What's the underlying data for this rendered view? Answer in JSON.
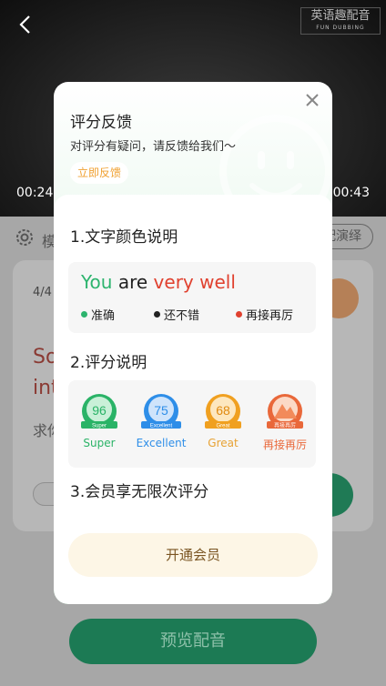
{
  "video": {
    "watermark_main": "英语趣配音",
    "watermark_sub": "FUN DUBBING",
    "time_current": "00:24",
    "time_total": "00:43"
  },
  "background": {
    "mode_label": "模",
    "rehearse_label": "配演绎",
    "page_indicator": "4/4",
    "sentence_fragment": "So\nint",
    "translation_fragment": "求你",
    "preview_button": "预览配音"
  },
  "modal": {
    "title": "评分反馈",
    "subtitle": "对评分有疑问，请反馈给我们～",
    "feedback_button": "立即反馈",
    "section1": {
      "title": "1.文字颜色说明",
      "sample_words": [
        {
          "text": "You",
          "color": "#2db46e"
        },
        {
          "text": "are",
          "color": "#222222"
        },
        {
          "text": "very well",
          "color": "#e0412f"
        }
      ],
      "legend": [
        {
          "label": "准确",
          "color": "#2db46e"
        },
        {
          "label": "还不错",
          "color": "#222222"
        },
        {
          "label": "再接再厉",
          "color": "#e0412f"
        }
      ]
    },
    "section2": {
      "title": "2.评分说明",
      "badges": [
        {
          "score": "96",
          "ribbon": "Super",
          "label": "Super",
          "color": "#2ab367",
          "light": "#c9f0d8"
        },
        {
          "score": "75",
          "ribbon": "Excellent",
          "label": "Excellent",
          "color": "#2e8ee8",
          "light": "#cfe4fb"
        },
        {
          "score": "68",
          "ribbon": "Great",
          "label": "Great",
          "color": "#f0a020",
          "light": "#fde7bf"
        },
        {
          "score": "",
          "ribbon": "再接再厉",
          "label": "再接再厉",
          "color": "#e9683a",
          "light": "#fbd9c6"
        }
      ]
    },
    "section3": {
      "title": "3.会员享无限次评分",
      "member_button": "开通会员"
    }
  }
}
